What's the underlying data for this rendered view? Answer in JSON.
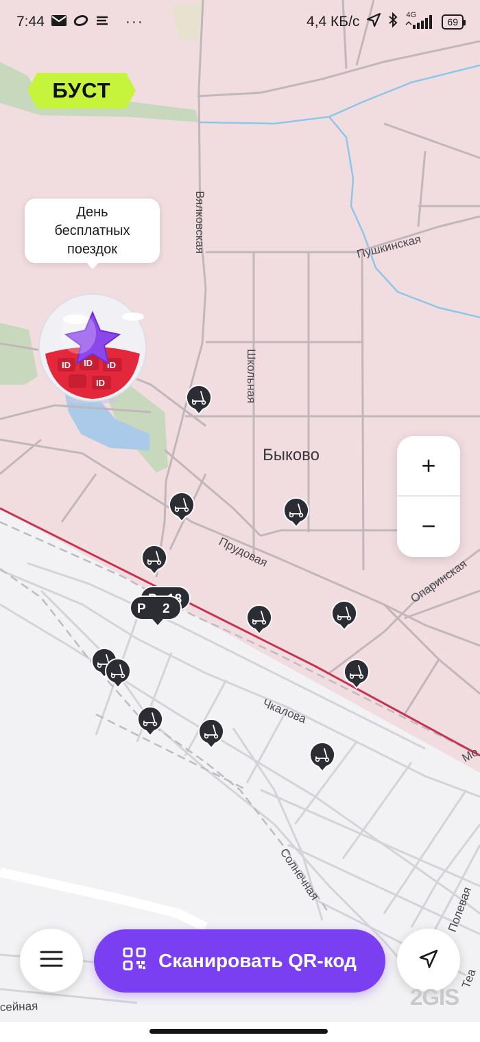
{
  "status_bar": {
    "time": "7:44",
    "more": "···",
    "network_speed": "4,4 КБ/с",
    "network_type": "4G",
    "battery": "69"
  },
  "icons": {
    "mail": "mail-icon",
    "notification": "circle-notification-icon",
    "notes": "menu-lines-icon",
    "location_arrow": "location-arrow-icon",
    "bluetooth": "bluetooth-icon",
    "signal": "signal-bars-icon",
    "battery": "battery-icon",
    "scooter": "scooter-icon",
    "qr": "qr-code-icon",
    "menu": "hamburger-menu-icon",
    "navigate": "navigation-arrow-icon"
  },
  "promo": {
    "badge": "БУСТ",
    "bubble_line1": "День",
    "bubble_line2": "бесплатных",
    "bubble_line3": "поездок",
    "globe_tag": "ID"
  },
  "map": {
    "district": "Быково",
    "streets": {
      "vyalkovskaya": "Вялковская",
      "pushkinskaya": "Пушкинская",
      "shkolnaya": "Школьная",
      "prudovaya": "Прудовая",
      "oparinskaya": "Опаринская",
      "chkalova": "Чкалова",
      "solnechnaya": "Солнечная",
      "polevaya": "Полевая",
      "seynaya": "сейная",
      "mo": "Мо",
      "tea": "Теа"
    },
    "parking_1_label": "P",
    "parking_1_count": "18",
    "parking_2_label": "P",
    "parking_2_count": "2"
  },
  "controls": {
    "zoom_in": "+",
    "zoom_out": "−",
    "scan_label": "Сканировать QR-код"
  },
  "brand": "2GIS",
  "colors": {
    "accent": "#7b3ff2",
    "badge": "#c6f43d",
    "map_zone": "#f1dde0",
    "map_outside": "#f2f1f4",
    "road": "#bfb4b8",
    "railway": "#c8334f",
    "water": "#8ec6ea",
    "park": "#c4d5b9",
    "pin": "#2c2c35"
  }
}
